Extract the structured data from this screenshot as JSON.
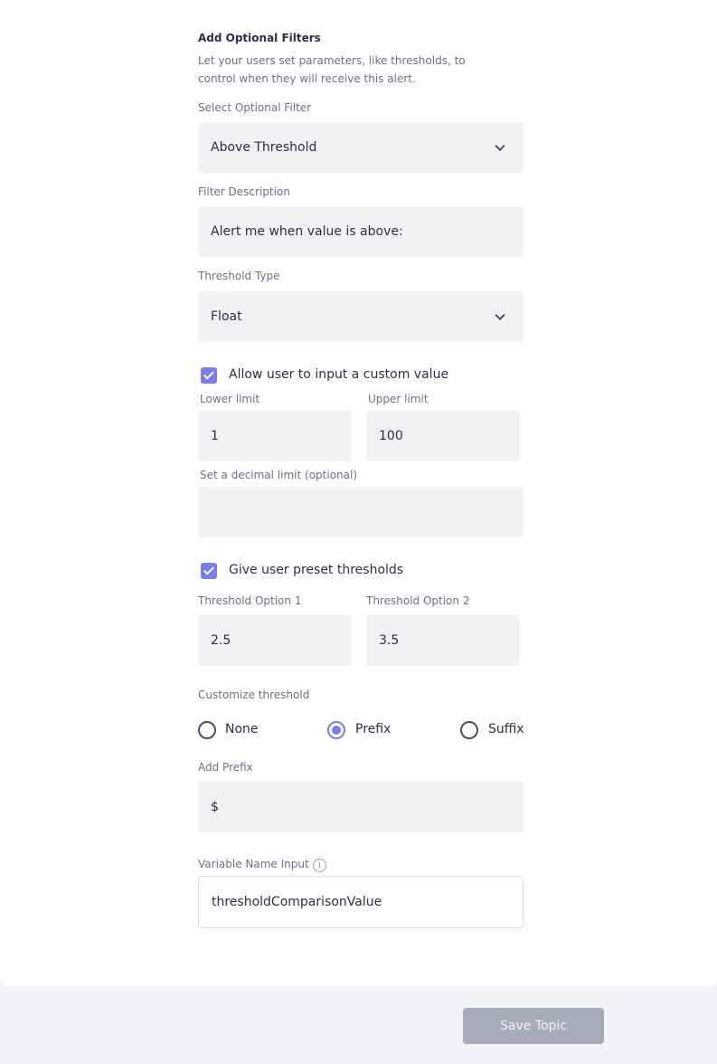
{
  "optional_filters": {
    "title": "Add Optional Filters",
    "description": "Let your users set parameters, like thresholds, to control when they will receive this alert."
  },
  "select_filter": {
    "label": "Select Optional Filter",
    "value": "Above Threshold"
  },
  "filter_description": {
    "label": "Filter Description",
    "value": "Alert me when value is above:"
  },
  "threshold_type": {
    "label": "Threshold Type",
    "value": "Float"
  },
  "custom_value": {
    "checked": true,
    "label": "Allow user to input a custom value",
    "lower_label": "Lower limit",
    "lower_value": "1",
    "upper_label": "Upper limit",
    "upper_value": "100",
    "decimal_label": "Set a decimal limit (optional)",
    "decimal_value": ""
  },
  "preset_thresholds": {
    "checked": true,
    "label": "Give user preset thresholds",
    "option1_label": "Threshold Option 1",
    "option1_value": "2.5",
    "option2_label": "Threshold Option 2",
    "option2_value": "3.5"
  },
  "customize": {
    "label": "Customize threshold",
    "options": [
      "None",
      "Prefix",
      "Suffix"
    ],
    "selected": "Prefix"
  },
  "prefix": {
    "label": "Add Prefix",
    "value": "$"
  },
  "variable_name": {
    "label": "Variable Name Input",
    "info_icon": "info-icon",
    "value": "thresholdComparisonValue"
  },
  "footer": {
    "save_label": "Save Topic"
  },
  "colors": {
    "accent": "#7b7ee6",
    "field_bg": "#f2f2f5",
    "button_disabled": "#a9abb8"
  }
}
